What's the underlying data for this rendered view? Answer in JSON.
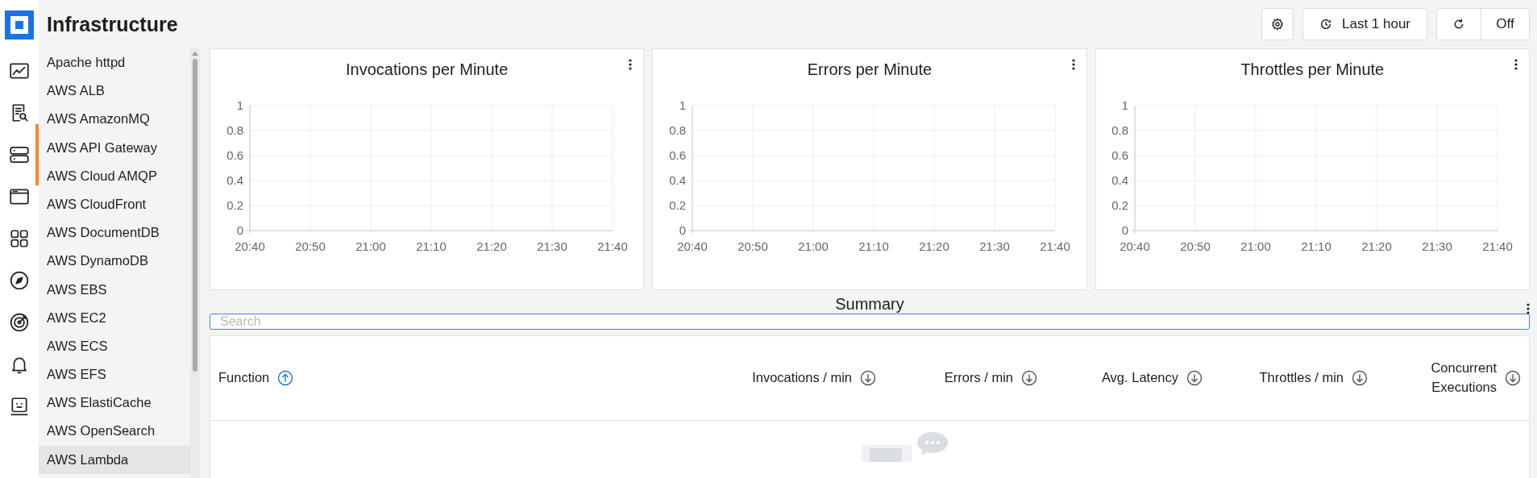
{
  "page_title": "Infrastructure",
  "nav": [
    {
      "kind": "logo",
      "selected": false
    },
    {
      "kind": "chart",
      "selected": false
    },
    {
      "kind": "report",
      "selected": false
    },
    {
      "kind": "servers",
      "selected": true
    },
    {
      "kind": "browser",
      "selected": false
    },
    {
      "kind": "grid",
      "selected": false
    },
    {
      "kind": "compass",
      "selected": false
    },
    {
      "kind": "target",
      "selected": false
    },
    {
      "kind": "bell",
      "selected": false
    },
    {
      "kind": "robot",
      "selected": false
    }
  ],
  "sidebar": {
    "items": [
      {
        "label": "Apache httpd",
        "selected": false
      },
      {
        "label": "AWS ALB",
        "selected": false
      },
      {
        "label": "AWS AmazonMQ",
        "selected": false
      },
      {
        "label": "AWS API Gateway",
        "selected": false
      },
      {
        "label": "AWS Cloud AMQP",
        "selected": false
      },
      {
        "label": "AWS CloudFront",
        "selected": false
      },
      {
        "label": "AWS DocumentDB",
        "selected": false
      },
      {
        "label": "AWS DynamoDB",
        "selected": false
      },
      {
        "label": "AWS EBS",
        "selected": false
      },
      {
        "label": "AWS EC2",
        "selected": false
      },
      {
        "label": "AWS ECS",
        "selected": false
      },
      {
        "label": "AWS EFS",
        "selected": false
      },
      {
        "label": "AWS ElastiCache",
        "selected": false
      },
      {
        "label": "AWS OpenSearch",
        "selected": false
      },
      {
        "label": "AWS Lambda",
        "selected": true
      }
    ]
  },
  "toolbar": {
    "time_range": "Last 1 hour",
    "refresh": "Off"
  },
  "charts": [
    {
      "chart_data": {
        "type": "line",
        "grid": true,
        "title": "Invocations per Minute",
        "categories": [
          "20:40",
          "20:50",
          "21:00",
          "21:10",
          "21:20",
          "21:30",
          "21:40"
        ],
        "ylim": [
          0,
          1
        ],
        "yticks": [
          0,
          0.2,
          0.4,
          0.6,
          0.8,
          1
        ]
      }
    },
    {
      "chart_data": {
        "type": "line",
        "grid": true,
        "title": "Errors per Minute",
        "categories": [
          "20:40",
          "20:50",
          "21:00",
          "21:10",
          "21:20",
          "21:30",
          "21:40"
        ],
        "ylim": [
          0,
          1
        ],
        "yticks": [
          0,
          0.2,
          0.4,
          0.6,
          0.8,
          1
        ]
      }
    },
    {
      "chart_data": {
        "type": "line",
        "grid": true,
        "title": "Throttles per Minute",
        "categories": [
          "20:40",
          "20:50",
          "21:00",
          "21:10",
          "21:20",
          "21:30",
          "21:40"
        ],
        "ylim": [
          0,
          1
        ],
        "yticks": [
          0,
          0.2,
          0.4,
          0.6,
          0.8,
          1
        ]
      }
    }
  ],
  "summary": {
    "title": "Summary",
    "search": {
      "placeholder": "Search"
    },
    "columns": [
      {
        "lines": [
          "Function"
        ],
        "kind": "ascending",
        "selected": true
      },
      {
        "lines": [
          "Invocations / min"
        ],
        "kind": "descending",
        "selected": false
      },
      {
        "lines": [
          "Errors / min"
        ],
        "kind": "descending",
        "selected": false
      },
      {
        "lines": [
          "Avg. Latency"
        ],
        "kind": "descending",
        "selected": false
      },
      {
        "lines": [
          "Throttles / min"
        ],
        "kind": "descending",
        "selected": false
      },
      {
        "lines": [
          "Concurrent",
          "Executions"
        ],
        "kind": "descending",
        "selected": false
      }
    ]
  }
}
